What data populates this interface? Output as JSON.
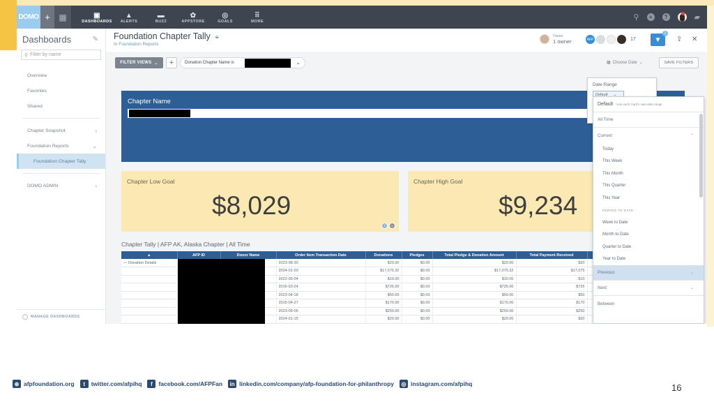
{
  "nav": {
    "logo": "DOMO",
    "items": [
      {
        "label": "DASHBOARDS",
        "icon": "dashboards-icon"
      },
      {
        "label": "ALERTS",
        "icon": "bell-icon"
      },
      {
        "label": "BUZZ",
        "icon": "chat-icon"
      },
      {
        "label": "APPSTORE",
        "icon": "appstore-icon"
      },
      {
        "label": "GOALS",
        "icon": "goals-icon"
      },
      {
        "label": "MORE",
        "icon": "grid-icon"
      }
    ]
  },
  "sidebar": {
    "title": "Dashboards",
    "search_placeholder": "Filter by name",
    "items": [
      {
        "label": "Overview"
      },
      {
        "label": "Favorites"
      },
      {
        "label": "Shared"
      }
    ],
    "folders": [
      {
        "label": "Chapter Snapshot",
        "chev": "›"
      },
      {
        "label": "Foundation Reports",
        "chev": "⌄"
      },
      {
        "label": "Foundation Chapter Tally"
      }
    ],
    "admin": {
      "label": "DOMO ADMIN",
      "chev": "›"
    },
    "manage": "MANAGE DASHBOARDS"
  },
  "page": {
    "title": "Foundation Chapter Tally",
    "subtitle": "In Foundation Reports",
    "owner_role": "Owner",
    "owner_count": "1 owner",
    "viewer_badge": "AFP",
    "viewer_count": "17",
    "filter_badge": "1"
  },
  "filterbar": {
    "filter_views": "FILTER VIEWS",
    "add": "+",
    "pill_label": "Donation Chapter Name is",
    "choose_date": "Choose Date",
    "save_filters": "SAVE FILTERS"
  },
  "cards": {
    "chapter_name_label": "Chapter Name",
    "low_goal_label": "Chapter Low Goal",
    "low_goal_value": "$8,029",
    "high_goal_label": "Chapter High Goal",
    "high_goal_value": "$9,234"
  },
  "table": {
    "title": "Chapter Tally | AFP AK, Alaska Chapter | All Time",
    "columns": [
      "AFP ID",
      "Donor Name",
      "Order Item Transaction Date",
      "Donations",
      "Pledges",
      "Total Pledge & Donation Amount",
      "Total Payment Received"
    ],
    "first_cell": "— Donation Details",
    "rows": [
      {
        "date": "2023-08-30",
        "donations": "$20.00",
        "pledges": "$0.00",
        "total": "$20.00",
        "paid": "$20"
      },
      {
        "date": "2024-01-20",
        "donations": "$17,075.32",
        "pledges": "$0.00",
        "total": "$17,075.32",
        "paid": "$17,075"
      },
      {
        "date": "2022-05-04",
        "donations": "$10.00",
        "pledges": "$0.00",
        "total": "$10.00",
        "paid": "$10"
      },
      {
        "date": "2016-03-24",
        "donations": "$725.00",
        "pledges": "$0.00",
        "total": "$725.00",
        "paid": "$725"
      },
      {
        "date": "2023-04-18",
        "donations": "$50.00",
        "pledges": "$0.00",
        "total": "$50.00",
        "paid": "$50"
      },
      {
        "date": "2015-04-27",
        "donations": "$170.00",
        "pledges": "$0.00",
        "total": "$170.00",
        "paid": "$170"
      },
      {
        "date": "2023-09-06",
        "donations": "$250.00",
        "pledges": "$0.00",
        "total": "$250.00",
        "paid": "$250"
      },
      {
        "date": "2024-01-15",
        "donations": "$20.00",
        "pledges": "$0.00",
        "total": "$20.00",
        "paid": "$20"
      }
    ]
  },
  "date_dropdown": {
    "label": "Date Range",
    "selected": "Default",
    "default_option": "Default",
    "default_hint": "Use each Card's own date range",
    "all_time": "All Time",
    "current": "Current",
    "current_items": [
      "Today",
      "This Week",
      "This Month",
      "This Quarter",
      "This Year"
    ],
    "period_header": "PERIOD TO DATE",
    "period_items": [
      "Week to Date",
      "Month to Date",
      "Quarter to Date",
      "Year to Date"
    ],
    "previous": "Previous",
    "next": "Next",
    "between": "Between"
  },
  "footer": {
    "website": "afpfoundation.org",
    "twitter": "twitter.com/afpihq",
    "facebook": "facebook.com/AFPFan",
    "linkedin": "linkedin.com/company/afp-foundation-for-philanthropy",
    "instagram": "instagram.com/afpihq",
    "page_number": "16"
  }
}
